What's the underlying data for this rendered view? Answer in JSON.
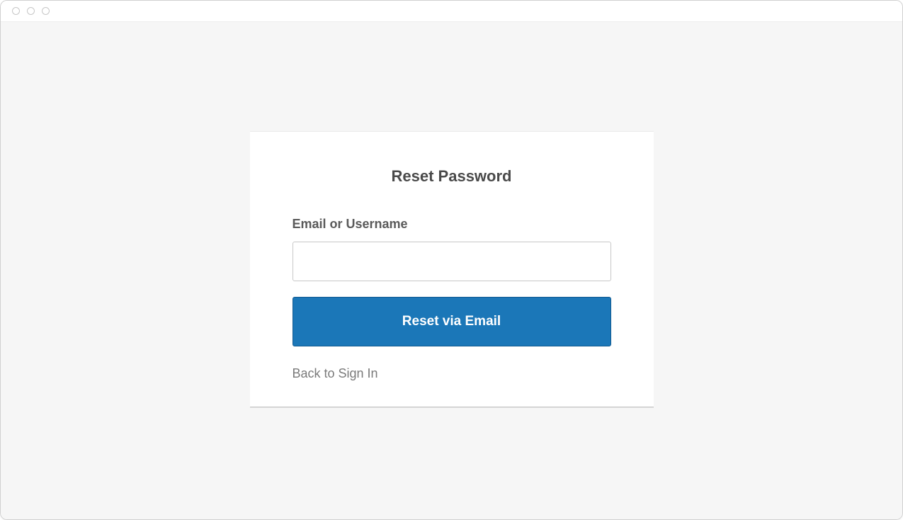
{
  "card": {
    "title": "Reset Password",
    "field_label": "Email or Username",
    "input_value": "",
    "input_placeholder": "",
    "submit_label": "Reset via Email",
    "back_link_label": "Back to Sign In"
  },
  "colors": {
    "primary": "#1b77b8",
    "page_bg": "#f6f6f6",
    "text_heading": "#4a4a4a",
    "text_label": "#5a5a5a",
    "text_muted": "#7a7a7a"
  }
}
